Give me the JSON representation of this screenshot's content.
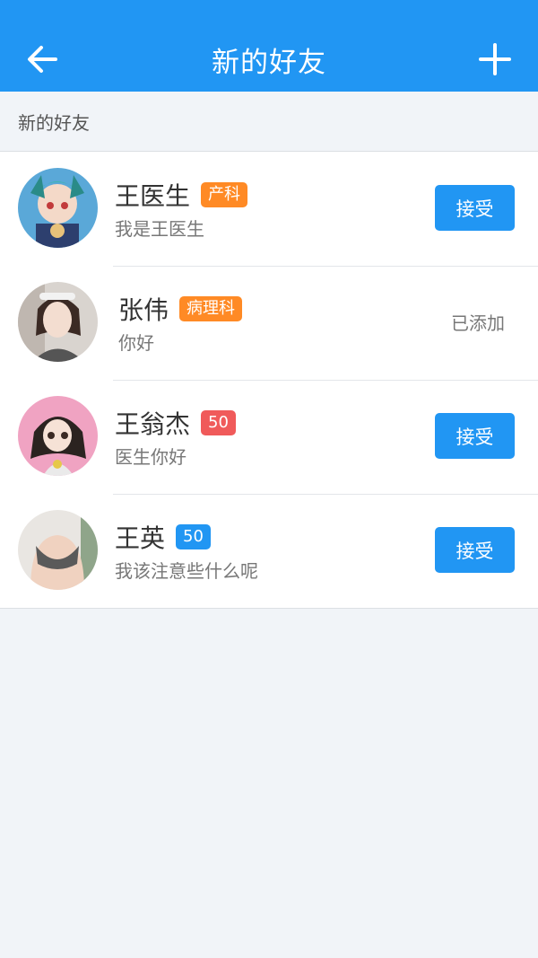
{
  "header": {
    "title": "新的好友",
    "back_icon": "arrow-left-icon",
    "add_icon": "plus-icon"
  },
  "section": {
    "title": "新的好友"
  },
  "colors": {
    "accent": "#2196f3",
    "tag_orange": "#ff8a25",
    "tag_red": "#f05a5a",
    "tag_blue": "#2196f3"
  },
  "friends": [
    {
      "name": "王医生",
      "tag": "产科",
      "tag_color": "#ff8a25",
      "message": "我是王医生",
      "action": "接受",
      "status": "pending",
      "avatar": "anime-avatar-teal"
    },
    {
      "name": "张伟",
      "tag": "病理科",
      "tag_color": "#ff8a25",
      "message": "你好",
      "action": "已添加",
      "status": "added",
      "avatar": "photo-avatar-woman"
    },
    {
      "name": "王翁杰",
      "tag": "50",
      "tag_color": "#f05a5a",
      "message": "医生你好",
      "action": "接受",
      "status": "pending",
      "avatar": "anime-avatar-pink"
    },
    {
      "name": "王英",
      "tag": "50",
      "tag_color": "#2196f3",
      "message": "我该注意些什么呢",
      "action": "接受",
      "status": "pending",
      "avatar": "photo-avatar-sport"
    }
  ]
}
